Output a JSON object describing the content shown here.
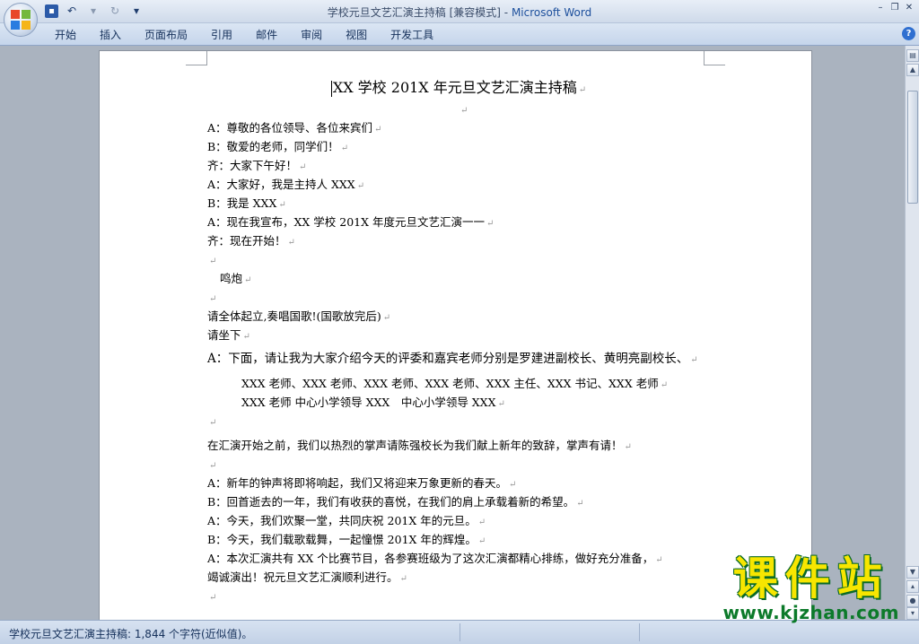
{
  "window": {
    "title": "学校元旦文艺汇演主持稿 [兼容模式]",
    "title_sep": " - ",
    "app_name": "Microsoft Word"
  },
  "ribbon": {
    "tabs": [
      "开始",
      "插入",
      "页面布局",
      "引用",
      "邮件",
      "审阅",
      "视图",
      "开发工具"
    ]
  },
  "document": {
    "title": "XX 学校 201X 年元旦文艺汇演主持稿",
    "lines": [
      "",
      "A：尊敬的各位领导、各位来宾们",
      "B：敬爱的老师，同学们！",
      "齐：大家下午好！",
      "A：大家好，我是主持人 XXX",
      "B：我是 XXX",
      "A：现在我宣布，XX 学校 201X 年度元旦文艺汇演一一",
      "齐：现在开始！",
      "",
      "鸣炮",
      "",
      "请全体起立,奏唱国歌!(国歌放完后)",
      "请坐下",
      "A：下面，请让我为大家介绍今天的评委和嘉宾老师分别是罗建进副校长、黄明亮副校长、",
      "XXX 老师、XXX 老师、XXX 老师、XXX 老师、XXX 主任、XXX 书记、XXX 老师",
      "XXX 老师 中心小学领导 XXX　中心小学领导 XXX",
      "",
      "在汇演开始之前，我们以热烈的掌声请陈强校长为我们献上新年的致辞，掌声有请！",
      "",
      "A：新年的钟声将即将响起，我们又将迎来万象更新的春天。",
      "B：回首逝去的一年，我们有收获的喜悦，在我们的肩上承载着新的希望。",
      "A：今天，我们欢聚一堂，共同庆祝 201X 年的元旦。",
      "B：今天，我们载歌载舞，一起憧憬 201X 年的辉煌。",
      "A：本次汇演共有 XX 个比赛节目，各参赛班级为了这次汇演都精心排练，做好充分准备，",
      "竭诚演出！祝元旦文艺汇演顺利进行。",
      ""
    ]
  },
  "status": {
    "text": "学校元旦文艺汇演主持稿: 1,844 个字符(近似值)。"
  },
  "watermark": {
    "main": "课件站",
    "url": "www.kjzhan.com"
  },
  "colors": {
    "app_name": "#1c4f9c",
    "watermark_fill": "#f7e600",
    "watermark_stroke": "#0a6a26"
  }
}
